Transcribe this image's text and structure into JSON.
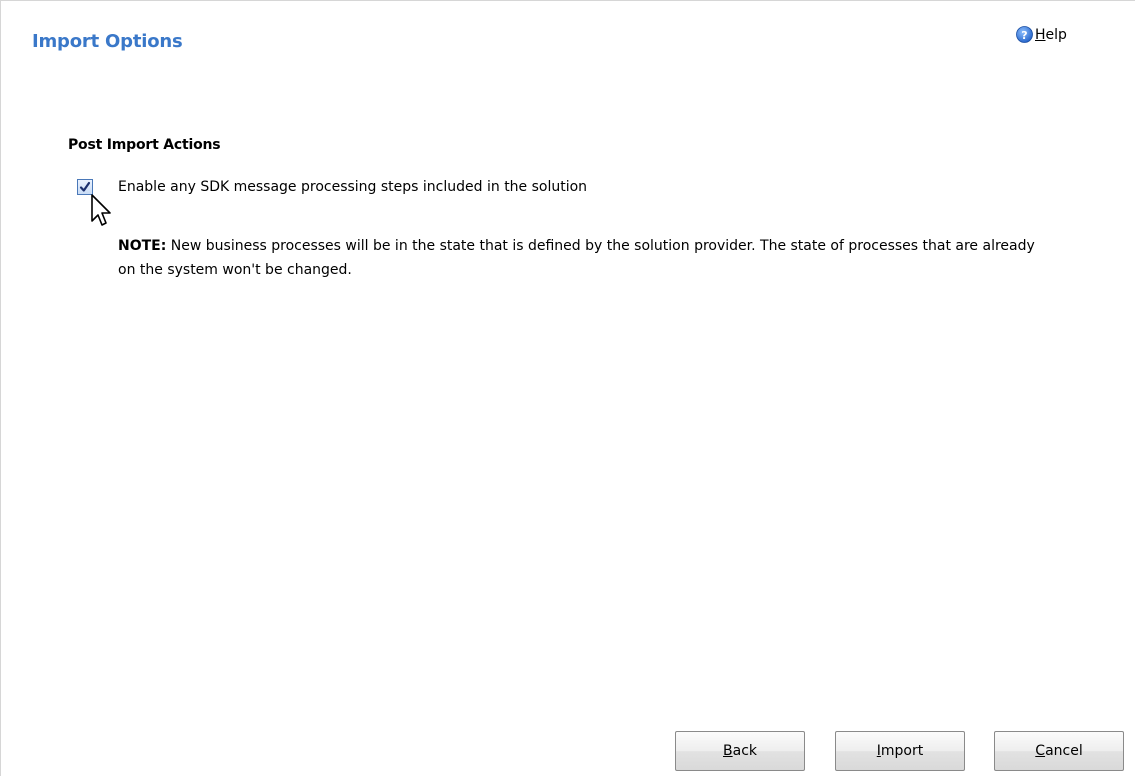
{
  "header": {
    "title": "Import Options",
    "help_label": "Help",
    "help_icon": "help-circle-icon"
  },
  "post_import": {
    "section_title": "Post Import Actions",
    "checkbox_label": "Enable any SDK message processing steps included in the solution",
    "checkbox_checked": true,
    "note_prefix": "NOTE:",
    "note_text": " New business processes will be in the state that is defined by the solution provider. The state of processes that are already on the system won't be changed."
  },
  "footer": {
    "back_label": "Back",
    "import_label": "Import",
    "cancel_label": "Cancel"
  },
  "colors": {
    "title": "#3a78c9",
    "checkbox_border": "#4a78b8"
  }
}
